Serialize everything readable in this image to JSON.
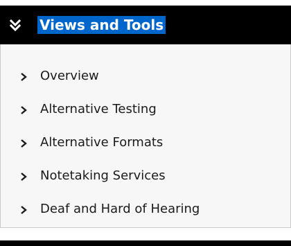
{
  "panel": {
    "title": "Views and Tools",
    "header_icon": "double-chevron-down-icon",
    "item_icon": "chevron-right-icon",
    "items": [
      {
        "label": "Overview"
      },
      {
        "label": "Alternative Testing"
      },
      {
        "label": "Alternative Formats"
      },
      {
        "label": "Notetaking Services"
      },
      {
        "label": "Deaf and Hard of Hearing"
      }
    ]
  },
  "colors": {
    "header_bg": "#000000",
    "title_highlight": "#0066cc",
    "body_bg": "#f7f7f7",
    "border": "#c8c8c8",
    "text": "#1a1a1a"
  }
}
